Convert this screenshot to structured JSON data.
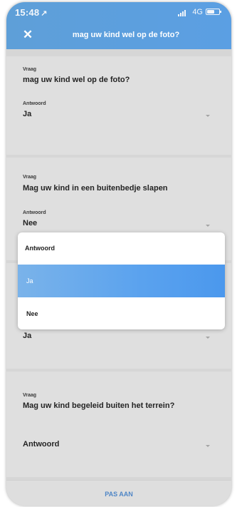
{
  "status_bar": {
    "time": "15:48",
    "location_glyph": "↗",
    "network": "4G"
  },
  "header": {
    "title": "mag uw kind wel op de foto?",
    "close_glyph": "✕"
  },
  "questions": [
    {
      "label": "Vraag",
      "question": "mag uw kind wel op de foto?",
      "answer_label": "Antwoord",
      "answer": "Ja"
    },
    {
      "label": "Vraag",
      "question": "Mag uw kind in een buitenbedje slapen",
      "answer_label": "Antwoord",
      "answer": "Nee"
    },
    {
      "answer": "Ja"
    },
    {
      "label": "Vraag",
      "question": "Mag uw kind begeleid buiten het terrein?",
      "answer": "Antwoord"
    }
  ],
  "dropdown": {
    "title": "Antwoord",
    "options": [
      {
        "label": "Ja",
        "selected": true
      },
      {
        "label": "Nee",
        "selected": false
      }
    ],
    "accent_color": "#5aa2ee"
  },
  "footer": {
    "submit_label": "PAS AAN"
  },
  "colors": {
    "header": "#5b9fe3",
    "submit_text": "#4f86c6"
  }
}
